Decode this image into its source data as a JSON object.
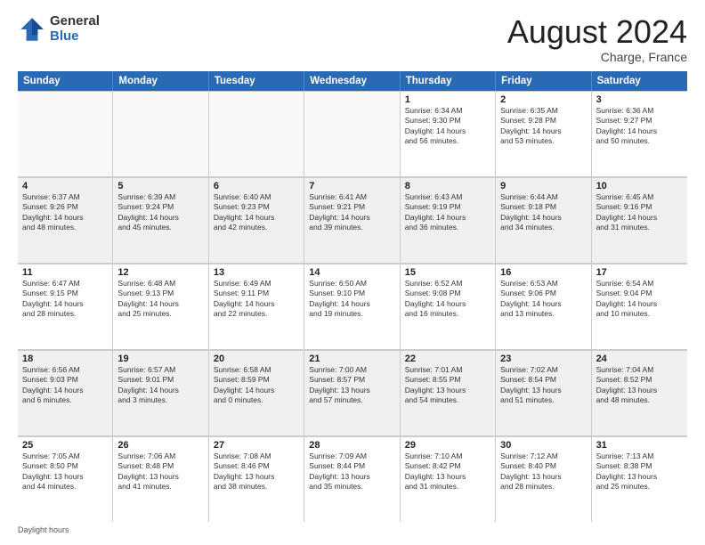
{
  "logo": {
    "general": "General",
    "blue": "Blue"
  },
  "title": "August 2024",
  "location": "Charge, France",
  "days": [
    "Sunday",
    "Monday",
    "Tuesday",
    "Wednesday",
    "Thursday",
    "Friday",
    "Saturday"
  ],
  "weeks": [
    [
      {
        "day": "",
        "empty": true
      },
      {
        "day": "",
        "empty": true
      },
      {
        "day": "",
        "empty": true
      },
      {
        "day": "",
        "empty": true
      },
      {
        "day": "1",
        "lines": [
          "Sunrise: 6:34 AM",
          "Sunset: 9:30 PM",
          "Daylight: 14 hours",
          "and 56 minutes."
        ]
      },
      {
        "day": "2",
        "lines": [
          "Sunrise: 6:35 AM",
          "Sunset: 9:28 PM",
          "Daylight: 14 hours",
          "and 53 minutes."
        ]
      },
      {
        "day": "3",
        "lines": [
          "Sunrise: 6:36 AM",
          "Sunset: 9:27 PM",
          "Daylight: 14 hours",
          "and 50 minutes."
        ]
      }
    ],
    [
      {
        "day": "4",
        "lines": [
          "Sunrise: 6:37 AM",
          "Sunset: 9:26 PM",
          "Daylight: 14 hours",
          "and 48 minutes."
        ]
      },
      {
        "day": "5",
        "lines": [
          "Sunrise: 6:39 AM",
          "Sunset: 9:24 PM",
          "Daylight: 14 hours",
          "and 45 minutes."
        ]
      },
      {
        "day": "6",
        "lines": [
          "Sunrise: 6:40 AM",
          "Sunset: 9:23 PM",
          "Daylight: 14 hours",
          "and 42 minutes."
        ]
      },
      {
        "day": "7",
        "lines": [
          "Sunrise: 6:41 AM",
          "Sunset: 9:21 PM",
          "Daylight: 14 hours",
          "and 39 minutes."
        ]
      },
      {
        "day": "8",
        "lines": [
          "Sunrise: 6:43 AM",
          "Sunset: 9:19 PM",
          "Daylight: 14 hours",
          "and 36 minutes."
        ]
      },
      {
        "day": "9",
        "lines": [
          "Sunrise: 6:44 AM",
          "Sunset: 9:18 PM",
          "Daylight: 14 hours",
          "and 34 minutes."
        ]
      },
      {
        "day": "10",
        "lines": [
          "Sunrise: 6:45 AM",
          "Sunset: 9:16 PM",
          "Daylight: 14 hours",
          "and 31 minutes."
        ]
      }
    ],
    [
      {
        "day": "11",
        "lines": [
          "Sunrise: 6:47 AM",
          "Sunset: 9:15 PM",
          "Daylight: 14 hours",
          "and 28 minutes."
        ]
      },
      {
        "day": "12",
        "lines": [
          "Sunrise: 6:48 AM",
          "Sunset: 9:13 PM",
          "Daylight: 14 hours",
          "and 25 minutes."
        ]
      },
      {
        "day": "13",
        "lines": [
          "Sunrise: 6:49 AM",
          "Sunset: 9:11 PM",
          "Daylight: 14 hours",
          "and 22 minutes."
        ]
      },
      {
        "day": "14",
        "lines": [
          "Sunrise: 6:50 AM",
          "Sunset: 9:10 PM",
          "Daylight: 14 hours",
          "and 19 minutes."
        ]
      },
      {
        "day": "15",
        "lines": [
          "Sunrise: 6:52 AM",
          "Sunset: 9:08 PM",
          "Daylight: 14 hours",
          "and 16 minutes."
        ]
      },
      {
        "day": "16",
        "lines": [
          "Sunrise: 6:53 AM",
          "Sunset: 9:06 PM",
          "Daylight: 14 hours",
          "and 13 minutes."
        ]
      },
      {
        "day": "17",
        "lines": [
          "Sunrise: 6:54 AM",
          "Sunset: 9:04 PM",
          "Daylight: 14 hours",
          "and 10 minutes."
        ]
      }
    ],
    [
      {
        "day": "18",
        "lines": [
          "Sunrise: 6:56 AM",
          "Sunset: 9:03 PM",
          "Daylight: 14 hours",
          "and 6 minutes."
        ]
      },
      {
        "day": "19",
        "lines": [
          "Sunrise: 6:57 AM",
          "Sunset: 9:01 PM",
          "Daylight: 14 hours",
          "and 3 minutes."
        ]
      },
      {
        "day": "20",
        "lines": [
          "Sunrise: 6:58 AM",
          "Sunset: 8:59 PM",
          "Daylight: 14 hours",
          "and 0 minutes."
        ]
      },
      {
        "day": "21",
        "lines": [
          "Sunrise: 7:00 AM",
          "Sunset: 8:57 PM",
          "Daylight: 13 hours",
          "and 57 minutes."
        ]
      },
      {
        "day": "22",
        "lines": [
          "Sunrise: 7:01 AM",
          "Sunset: 8:55 PM",
          "Daylight: 13 hours",
          "and 54 minutes."
        ]
      },
      {
        "day": "23",
        "lines": [
          "Sunrise: 7:02 AM",
          "Sunset: 8:54 PM",
          "Daylight: 13 hours",
          "and 51 minutes."
        ]
      },
      {
        "day": "24",
        "lines": [
          "Sunrise: 7:04 AM",
          "Sunset: 8:52 PM",
          "Daylight: 13 hours",
          "and 48 minutes."
        ]
      }
    ],
    [
      {
        "day": "25",
        "lines": [
          "Sunrise: 7:05 AM",
          "Sunset: 8:50 PM",
          "Daylight: 13 hours",
          "and 44 minutes."
        ]
      },
      {
        "day": "26",
        "lines": [
          "Sunrise: 7:06 AM",
          "Sunset: 8:48 PM",
          "Daylight: 13 hours",
          "and 41 minutes."
        ]
      },
      {
        "day": "27",
        "lines": [
          "Sunrise: 7:08 AM",
          "Sunset: 8:46 PM",
          "Daylight: 13 hours",
          "and 38 minutes."
        ]
      },
      {
        "day": "28",
        "lines": [
          "Sunrise: 7:09 AM",
          "Sunset: 8:44 PM",
          "Daylight: 13 hours",
          "and 35 minutes."
        ]
      },
      {
        "day": "29",
        "lines": [
          "Sunrise: 7:10 AM",
          "Sunset: 8:42 PM",
          "Daylight: 13 hours",
          "and 31 minutes."
        ]
      },
      {
        "day": "30",
        "lines": [
          "Sunrise: 7:12 AM",
          "Sunset: 8:40 PM",
          "Daylight: 13 hours",
          "and 28 minutes."
        ]
      },
      {
        "day": "31",
        "lines": [
          "Sunrise: 7:13 AM",
          "Sunset: 8:38 PM",
          "Daylight: 13 hours",
          "and 25 minutes."
        ]
      }
    ]
  ],
  "footer": "Daylight hours"
}
